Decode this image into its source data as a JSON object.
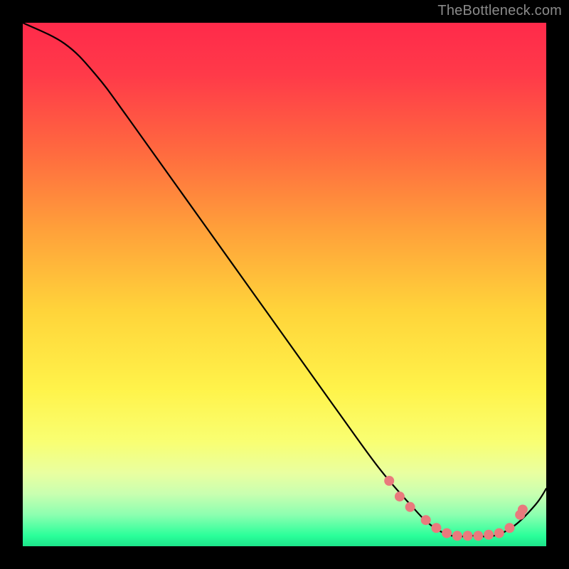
{
  "watermark": "TheBottleneck.com",
  "chart_data": {
    "type": "line",
    "x": [
      0.0,
      0.08,
      0.14,
      0.2,
      0.3,
      0.4,
      0.5,
      0.6,
      0.68,
      0.74,
      0.78,
      0.82,
      0.86,
      0.9,
      0.94,
      0.98,
      1.0
    ],
    "values": [
      1.0,
      0.96,
      0.9,
      0.82,
      0.68,
      0.54,
      0.4,
      0.26,
      0.15,
      0.08,
      0.04,
      0.02,
      0.02,
      0.02,
      0.04,
      0.08,
      0.11
    ],
    "title": "",
    "xlabel": "",
    "ylabel": "",
    "xlim": [
      0,
      1
    ],
    "ylim": [
      0,
      1
    ],
    "curve_color": "#000000",
    "curve_width": 2.2,
    "dot_color": "#e97a7d",
    "dot_radius": 7,
    "dot_points_x": [
      0.7,
      0.72,
      0.74,
      0.77,
      0.79,
      0.81,
      0.83,
      0.85,
      0.87,
      0.89,
      0.91,
      0.93,
      0.95,
      0.955
    ],
    "dot_points_y": [
      0.125,
      0.095,
      0.075,
      0.05,
      0.035,
      0.025,
      0.02,
      0.02,
      0.02,
      0.022,
      0.025,
      0.035,
      0.06,
      0.07
    ],
    "gradient_stops": [
      {
        "offset": 0.0,
        "color": "#ff2a4a"
      },
      {
        "offset": 0.1,
        "color": "#ff3a49"
      },
      {
        "offset": 0.25,
        "color": "#ff6b3f"
      },
      {
        "offset": 0.4,
        "color": "#ffa23a"
      },
      {
        "offset": 0.55,
        "color": "#ffd43a"
      },
      {
        "offset": 0.7,
        "color": "#fff34a"
      },
      {
        "offset": 0.8,
        "color": "#f9ff72"
      },
      {
        "offset": 0.86,
        "color": "#e9ffa0"
      },
      {
        "offset": 0.9,
        "color": "#c9ffb0"
      },
      {
        "offset": 0.94,
        "color": "#8cffb0"
      },
      {
        "offset": 0.98,
        "color": "#2aff9a"
      },
      {
        "offset": 1.0,
        "color": "#1de38a"
      }
    ]
  }
}
